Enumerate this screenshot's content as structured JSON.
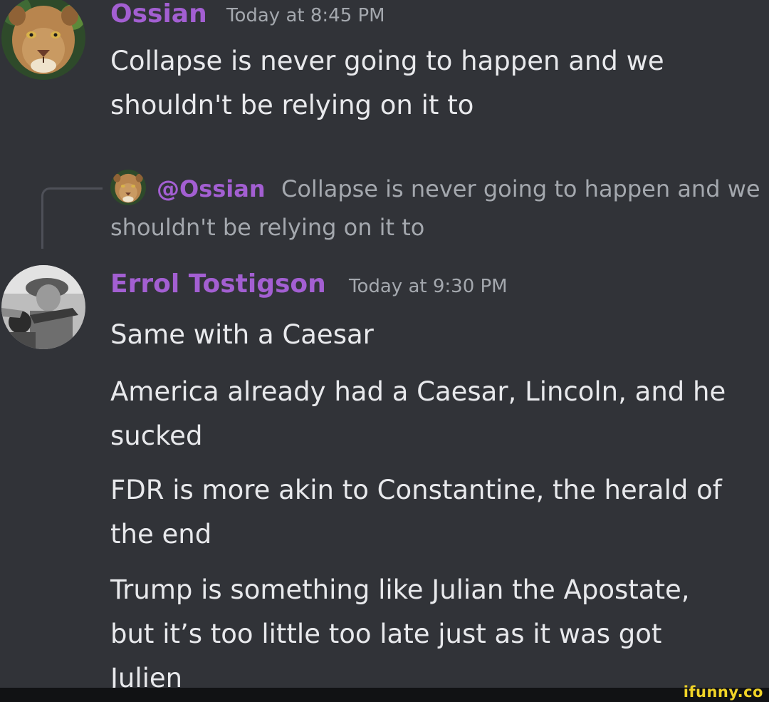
{
  "messages": [
    {
      "username": "Ossian",
      "timestamp": "Today at 8:45 PM",
      "avatar_icon": "cougar-avatar",
      "text": "Collapse is never going to happen and we\nshouldn't be relying on it to"
    },
    {
      "username": "Errol Tostigson",
      "timestamp": "Today at 9:30 PM",
      "avatar_icon": "soldier-photo-avatar",
      "reply": {
        "mention": "@Ossian",
        "text": "Collapse is never going to happen and we shouldn't be relying on it to"
      },
      "lines": [
        "Same with a Caesar",
        "America already had a Caesar, Lincoln, and he\nsucked",
        "FDR is more akin to Constantine, the herald of\nthe end",
        "Trump is something like Julian the Apostate,\nbut it’s too little too late just as it was got\nJulien"
      ]
    }
  ],
  "watermark": "ifunny.co",
  "colors": {
    "background": "#313338",
    "username": "#a35fd2",
    "timestamp": "#a4a8ae",
    "message_text": "#e8e9ec",
    "watermark": "#f0d327"
  }
}
